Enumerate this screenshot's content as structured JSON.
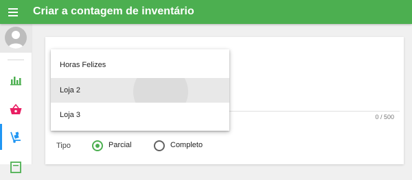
{
  "app": {
    "title": "Criar a contagem de inventário"
  },
  "icons": {
    "menu": "menu-icon",
    "avatar": "user-avatar-icon",
    "nav": [
      "bar-chart-icon",
      "basket-icon",
      "hand-truck-icon",
      "document-icon"
    ]
  },
  "colors": {
    "primary": "#4caf50",
    "nav_active": "#2196f3",
    "basket": "#e91e63"
  },
  "form": {
    "counter": "0 / 500",
    "type_label": "Tipo",
    "type_options": [
      {
        "label": "Parcial",
        "selected": true
      },
      {
        "label": "Completo",
        "selected": false
      }
    ]
  },
  "dropdown": {
    "options": [
      "Horas Felizes",
      "Loja 2",
      "Loja 3"
    ],
    "highlighted": "Loja 2"
  }
}
